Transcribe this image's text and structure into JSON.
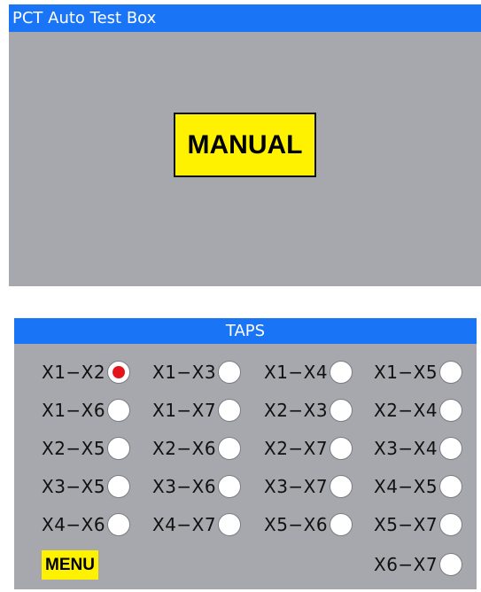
{
  "window": {
    "title": "PCT Auto Test Box"
  },
  "mode": {
    "label": "MANUAL",
    "box_color": "#fff200"
  },
  "taps": {
    "title": "TAPS",
    "selected": "X1-X2",
    "items": [
      {
        "label": "X1−X2",
        "selected": true
      },
      {
        "label": "X1−X3",
        "selected": false
      },
      {
        "label": "X1−X4",
        "selected": false
      },
      {
        "label": "X1−X5",
        "selected": false
      },
      {
        "label": "X1−X6",
        "selected": false
      },
      {
        "label": "X1−X7",
        "selected": false
      },
      {
        "label": "X2−X3",
        "selected": false
      },
      {
        "label": "X2−X4",
        "selected": false
      },
      {
        "label": "X2−X5",
        "selected": false
      },
      {
        "label": "X2−X6",
        "selected": false
      },
      {
        "label": "X2−X7",
        "selected": false
      },
      {
        "label": "X3−X4",
        "selected": false
      },
      {
        "label": "X3−X5",
        "selected": false
      },
      {
        "label": "X3−X6",
        "selected": false
      },
      {
        "label": "X3−X7",
        "selected": false
      },
      {
        "label": "X4−X5",
        "selected": false
      },
      {
        "label": "X4−X6",
        "selected": false
      },
      {
        "label": "X4−X7",
        "selected": false
      },
      {
        "label": "X5−X6",
        "selected": false
      },
      {
        "label": "X5−X7",
        "selected": false
      },
      {
        "label": "X6−X7",
        "selected": false
      }
    ]
  },
  "menu": {
    "label": "MENU"
  },
  "colors": {
    "titlebar": "#1a74f6",
    "panel": "#a6a8ad",
    "accent_yellow": "#fff200",
    "radio_selected": "#e5141c"
  }
}
